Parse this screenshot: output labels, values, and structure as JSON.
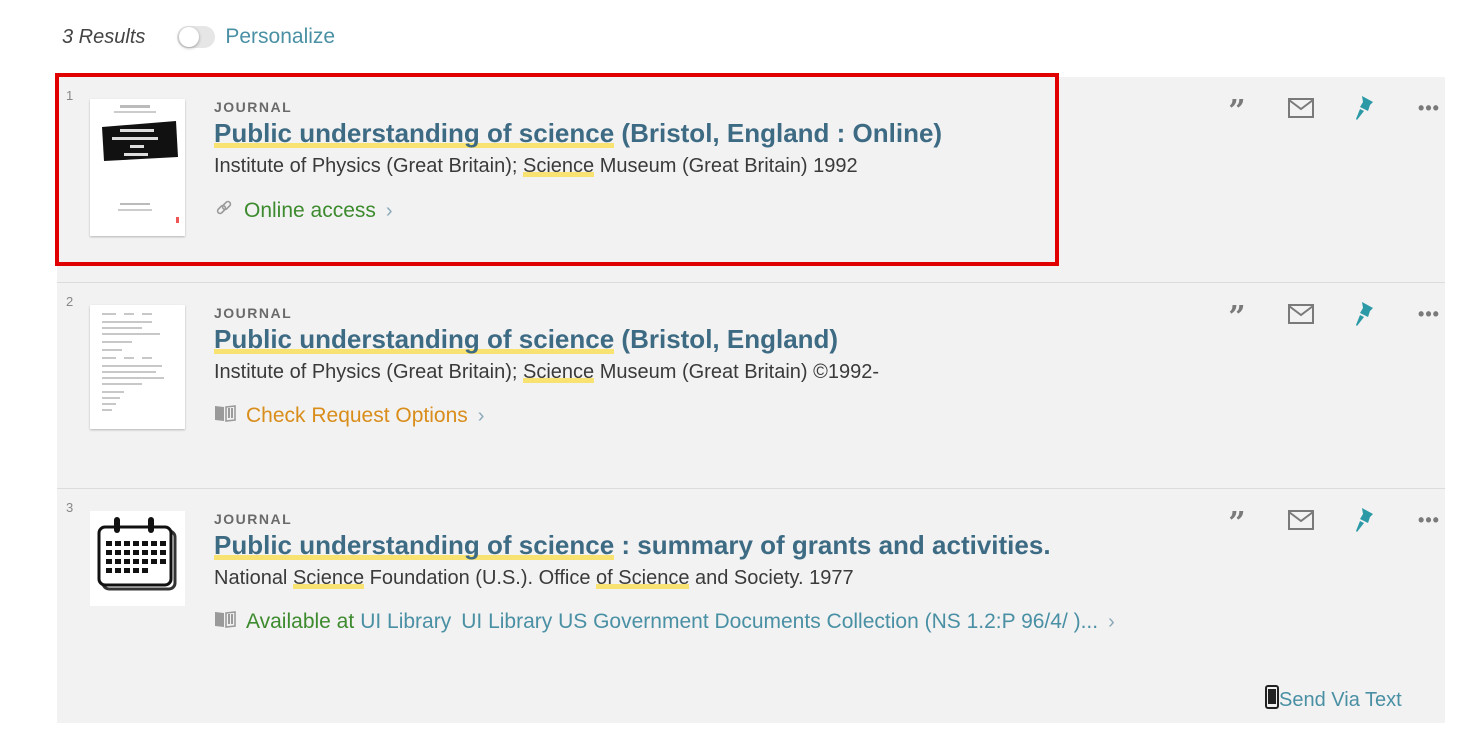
{
  "header": {
    "results": "3 Results",
    "personalize": "Personalize"
  },
  "results": [
    {
      "number": "1",
      "type": "JOURNAL",
      "title_highlight": "Public understanding of science",
      "title_rest": " (Bristol, England : Online)",
      "meta_pre": "Institute of Physics (Great Britain); ",
      "meta_hl": "Science",
      "meta_post": " Museum (Great Britain) 1992",
      "availability": "Online access",
      "availability_status": "online"
    },
    {
      "number": "2",
      "type": "JOURNAL",
      "title_highlight": "Public understanding of science",
      "title_rest": " (Bristol, England)",
      "meta_pre": "Institute of Physics (Great Britain); ",
      "meta_hl": "Science",
      "meta_post": " Museum (Great Britain) ©1992-",
      "availability": "Check Request Options",
      "availability_status": "request"
    },
    {
      "number": "3",
      "type": "JOURNAL",
      "title_highlight": "Public understanding of science",
      "title_rest": " : summary of grants and activities.",
      "meta_a": "National ",
      "meta_b": "Science",
      "meta_c": " Foundation (U.S.). Office ",
      "meta_d": "of Science",
      "meta_e": " and Society. 1977",
      "availability": "Available at",
      "location": "UI Library",
      "collection": "UI Library US Government Documents Collection (NS 1.2:P 96/4/ )...",
      "availability_status": "available",
      "send_text": "Send Via Text"
    }
  ],
  "colors": {
    "title": "#3e6b84",
    "highlight": "#f7e272",
    "online": "#3d8b2e",
    "request": "#d98d1a",
    "link": "#4a90a4",
    "pin": "#2b9aa6",
    "selection_box": "#e10000"
  },
  "icons": {
    "actions": [
      "citation-icon",
      "email-icon",
      "pin-icon",
      "more-icon"
    ],
    "online": "link-icon",
    "physical": "book-icon",
    "send": "phone-icon"
  }
}
